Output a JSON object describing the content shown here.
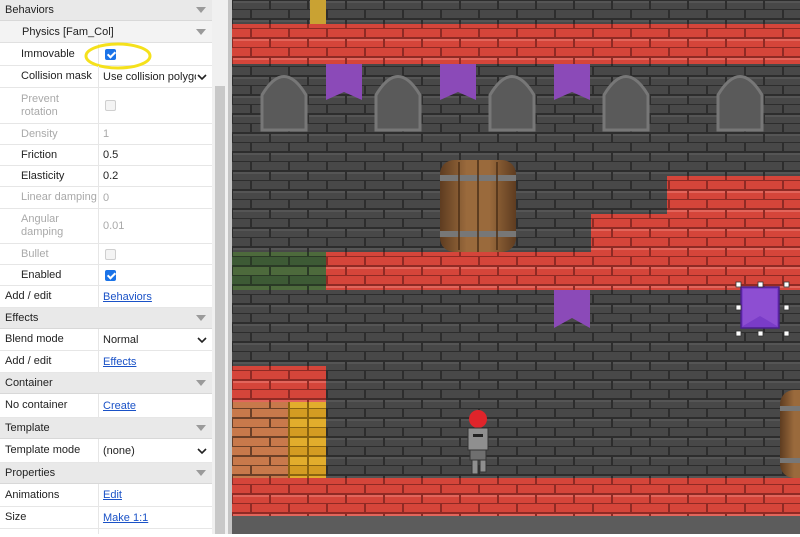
{
  "sections": {
    "behaviors": "Behaviors",
    "effects": "Effects",
    "container": "Container",
    "template": "Template",
    "properties": "Properties"
  },
  "physics_behavior": {
    "title": "Physics [Fam_Col]",
    "rows": {
      "immovable": {
        "label": "Immovable",
        "checked": true
      },
      "collision_mask": {
        "label": "Collision mask",
        "value": "Use collision polygo"
      },
      "prevent_rotation": {
        "label": "Prevent rotation",
        "checked": false
      },
      "density": {
        "label": "Density",
        "value": "1"
      },
      "friction": {
        "label": "Friction",
        "value": "0.5"
      },
      "elasticity": {
        "label": "Elasticity",
        "value": "0.2"
      },
      "linear_damping": {
        "label": "Linear damping",
        "value": "0"
      },
      "angular_damping": {
        "label": "Angular damping",
        "value": "0.01"
      },
      "bullet": {
        "label": "Bullet",
        "checked": false
      },
      "enabled": {
        "label": "Enabled",
        "checked": true
      }
    }
  },
  "behaviors_add": {
    "label": "Add / edit",
    "link": "Behaviors"
  },
  "effects": {
    "blend_label": "Blend mode",
    "blend_value": "Normal",
    "add_label": "Add / edit",
    "add_link": "Effects"
  },
  "container": {
    "label": "No container",
    "link": "Create"
  },
  "template": {
    "label": "Template mode",
    "value": "(none)"
  },
  "properties": {
    "animations_label": "Animations",
    "animations_link": "Edit",
    "size_label": "Size",
    "size_link": "Make 1:1"
  },
  "colors": {
    "accent": "#1a73e8",
    "highlight_circle": "#f5e11c",
    "link": "#1a52c7",
    "wall_dark": "#3f3f3f",
    "brick_red": "#d5453a",
    "selection": "#7a3cc8"
  },
  "canvas": {
    "objects": [
      "red-brick-wall",
      "barrel",
      "stone-arch-window",
      "purple-banner",
      "knight-character",
      "selected-collision-box"
    ]
  }
}
